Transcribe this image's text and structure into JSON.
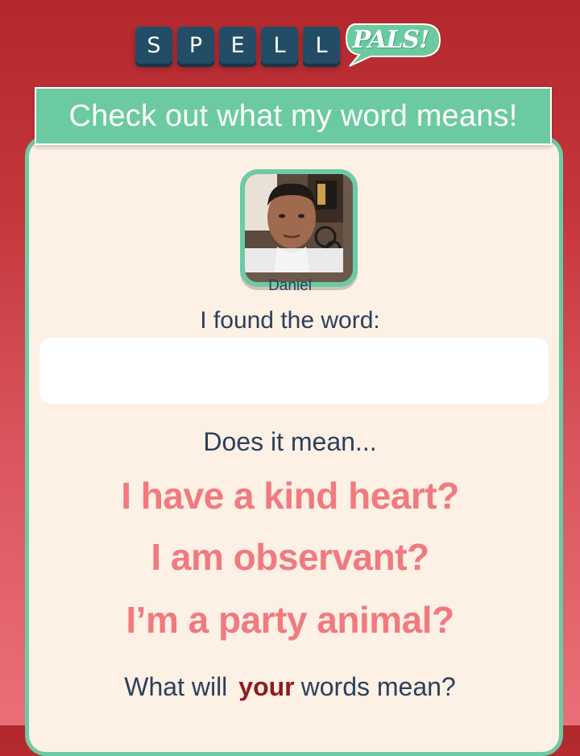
{
  "logo": {
    "tiles": [
      "S",
      "P",
      "E",
      "L",
      "L"
    ],
    "badge_text": "PALS!"
  },
  "banner": {
    "text": "Check out what my word means!"
  },
  "profile": {
    "name": "Daniel",
    "avatar_alt": "profile photo"
  },
  "prompt": {
    "found_text": "I found the word:",
    "word_value": ""
  },
  "question": {
    "text": "Does it mean..."
  },
  "options": [
    "I have a kind heart?",
    "I am observant?",
    "I’m a party animal?"
  ],
  "footer": {
    "before": "What will",
    "emphasis": "your",
    "after": "words mean?"
  },
  "colors": {
    "background": "#c5373d",
    "accent_green": "#6ccaa5",
    "tile_blue": "#234d66",
    "card": "#fdf0e4",
    "option_pink": "#f07a80",
    "text_navy": "#2c3f5c",
    "emphasis_red": "#8f1b22"
  }
}
